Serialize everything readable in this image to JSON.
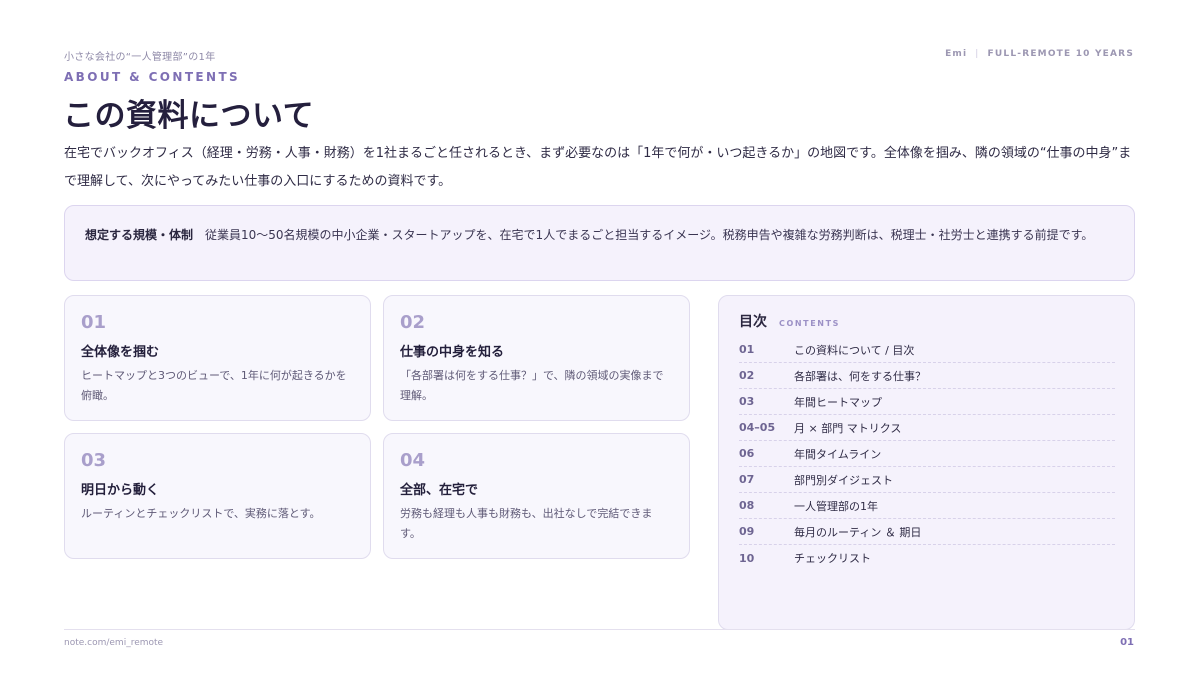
{
  "header": {
    "series_title": "小さな会社の“一人管理部”の1年",
    "author": "Emi",
    "tagline": "FULL-REMOTE 10 YEARS"
  },
  "section": {
    "eyebrow": "ABOUT & CONTENTS",
    "title": "この資料について",
    "intro": "在宅でバックオフィス（経理・労務・人事・財務）を1社まるごと任されるとき、まず必要なのは「1年で何が・いつ起きるか」の地図です。全体像を掴み、隣の領域の“仕事の中身”まで理解して、次にやってみたい仕事の入口にするための資料です。"
  },
  "scope": {
    "label": "想定する規模・体制",
    "text": "従業員10〜50名規模の中小企業・スタートアップを、在宅で1人でまるごと担当するイメージ。税務申告や複雑な労務判断は、税理士・社労士と連携する前提です。"
  },
  "cards": [
    {
      "num": "01",
      "title": "全体像を掴む",
      "desc": "ヒートマップと3つのビューで、1年に何が起きるかを俯瞰。"
    },
    {
      "num": "02",
      "title": "仕事の中身を知る",
      "desc": "「各部署は何をする仕事？」で、隣の領域の実像まで理解。"
    },
    {
      "num": "03",
      "title": "明日から動く",
      "desc": "ルーティンとチェックリストで、実務に落とす。"
    },
    {
      "num": "04",
      "title": "全部、在宅で",
      "desc": "労務も経理も人事も財務も、出社なしで完結できます。"
    }
  ],
  "toc": {
    "title": "目次",
    "subtitle": "CONTENTS",
    "items": [
      {
        "num": "01",
        "label": "この資料について / 目次"
      },
      {
        "num": "02",
        "label": "各部署は、何をする仕事？"
      },
      {
        "num": "03",
        "label": "年間ヒートマップ"
      },
      {
        "num": "04–05",
        "label": "月 × 部門 マトリクス"
      },
      {
        "num": "06",
        "label": "年間タイムライン"
      },
      {
        "num": "07",
        "label": "部門別ダイジェスト"
      },
      {
        "num": "08",
        "label": "一人管理部の1年"
      },
      {
        "num": "09",
        "label": "毎月のルーティン ＆ 期日"
      },
      {
        "num": "10",
        "label": "チェックリスト"
      }
    ]
  },
  "footer": {
    "url": "note.com/emi_remote",
    "page": "01"
  }
}
